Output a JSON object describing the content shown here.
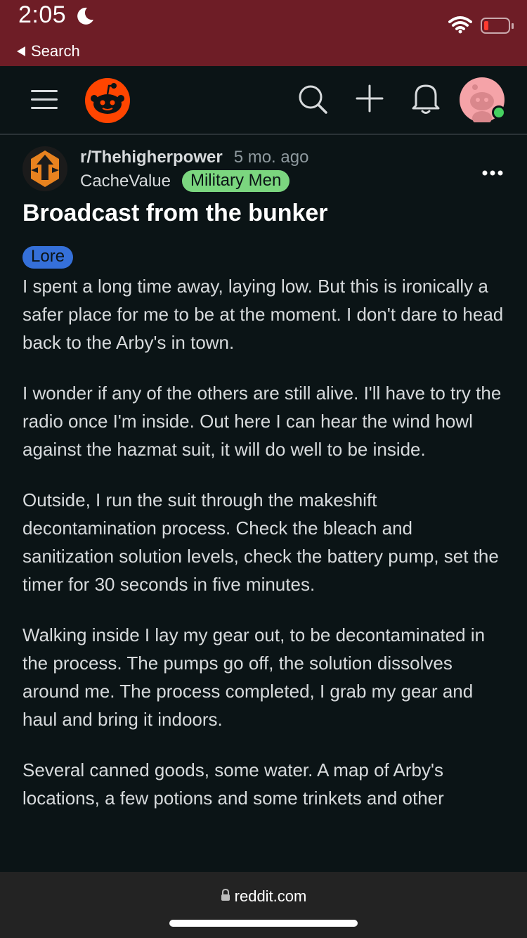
{
  "status_bar": {
    "time": "2:05",
    "back_label": "Search"
  },
  "nav": {
    "icons": [
      "menu-icon",
      "reddit-logo",
      "search-icon",
      "plus-icon",
      "bell-icon",
      "avatar"
    ],
    "accent": "#ff4500"
  },
  "post": {
    "subreddit": "r/Thehigherpower",
    "age": "5 mo. ago",
    "author": "CacheValue",
    "user_flair": "Military Men",
    "title": "Broadcast from the bunker",
    "post_flair": "Lore",
    "paragraphs": [
      "I spent a long time away, laying low. But this is ironically a safer place for me to be at the moment. I don't dare to head back to the Arby's in town.",
      "I wonder if any of the others are still alive. I'll have to try the radio once I'm inside. Out here I can hear the wind howl against the hazmat suit, it will do well to be inside.",
      "Outside, I run the suit through the makeshift decontamination process. Check the bleach and sanitization solution levels, check the battery pump, set the timer for 30 seconds in five minutes.",
      "Walking inside I lay my gear out, to be decontaminated in the process. The pumps go off, the solution dissolves around me. The process completed, I grab my gear and haul and bring it indoors.",
      "Several canned goods, some water. A map of Arby's locations, a few potions and some trinkets and other"
    ]
  },
  "browser": {
    "url": "reddit.com"
  },
  "colors": {
    "status_bar_bg": "#6e1d26",
    "page_bg": "#0b1416",
    "user_flair_bg": "#7bd67f",
    "post_flair_bg": "#3570d9"
  }
}
